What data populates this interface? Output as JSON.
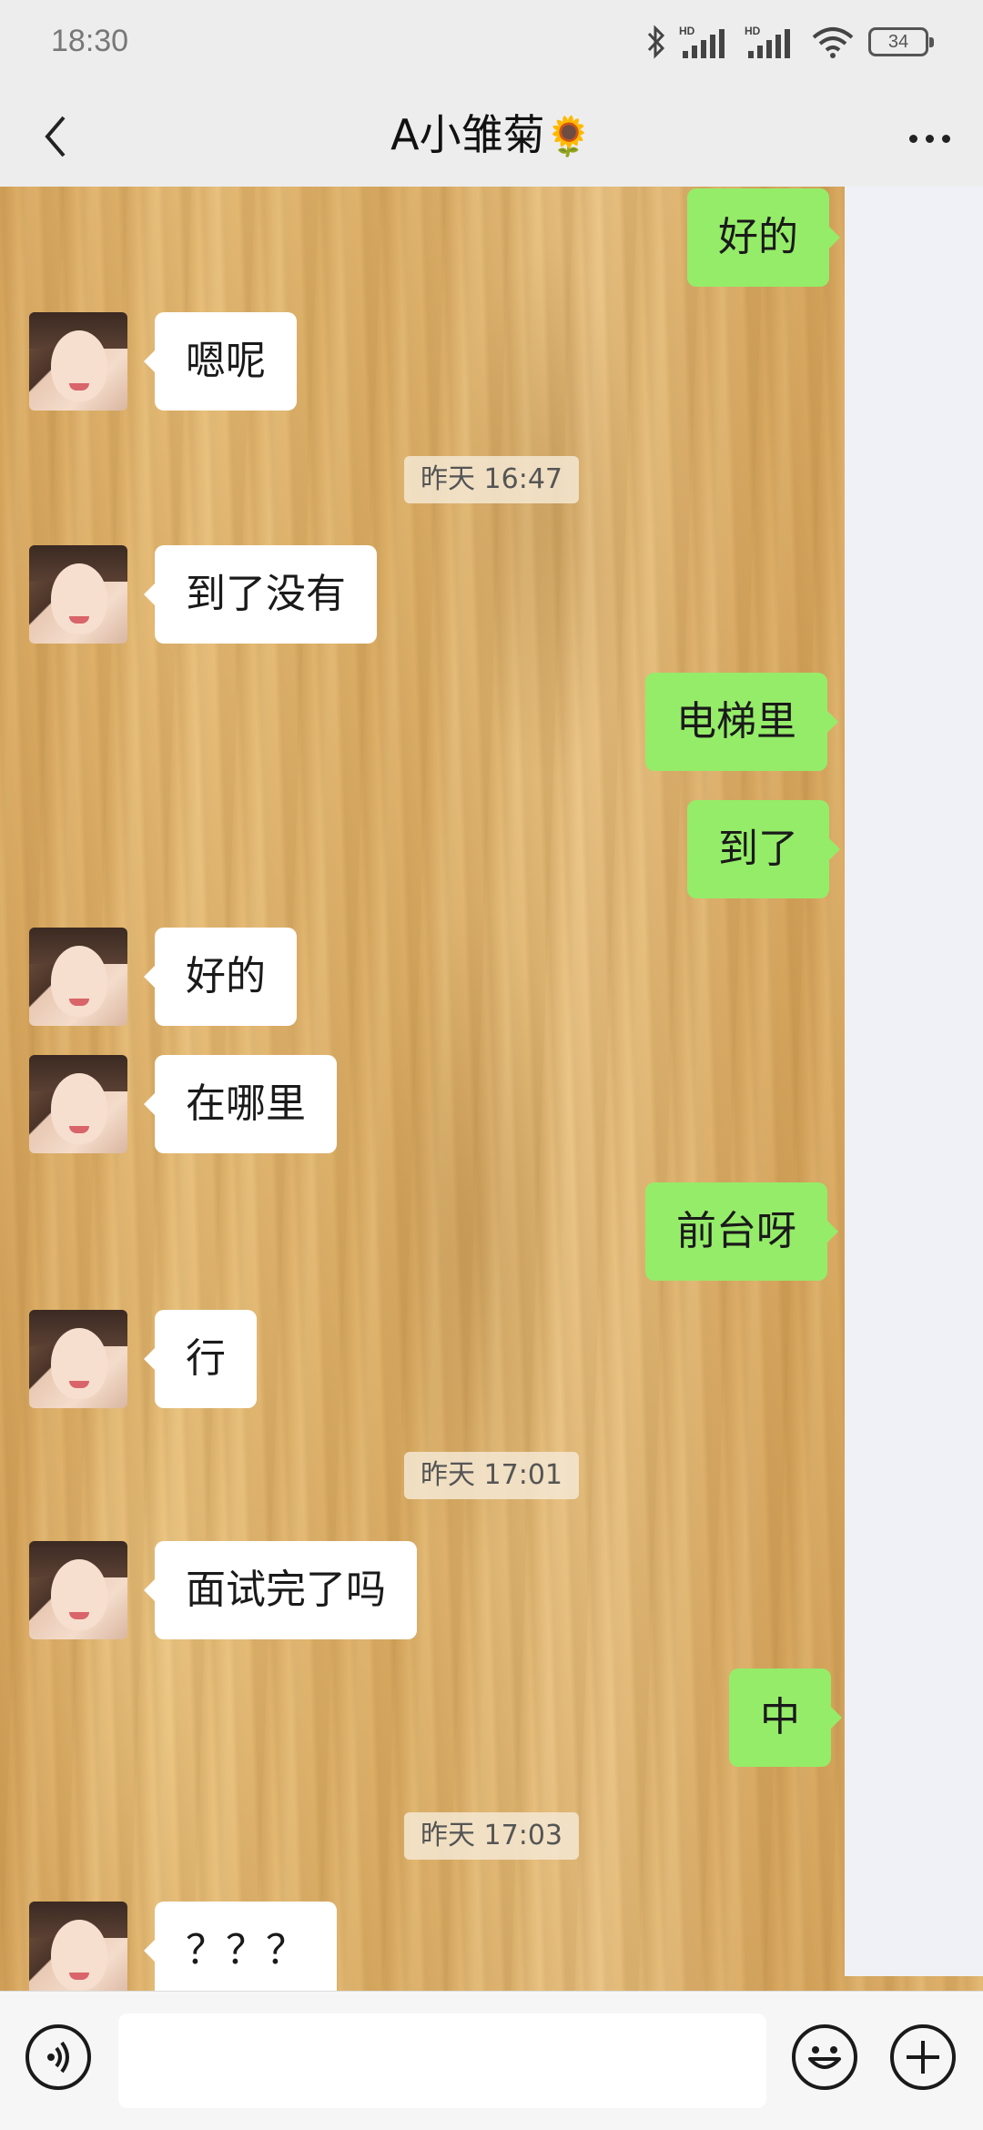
{
  "status_bar": {
    "time": "18:30",
    "battery": "34",
    "icons": [
      "bluetooth-icon",
      "hd-signal-icon",
      "hd-signal-icon",
      "wifi-icon",
      "battery-icon"
    ]
  },
  "header": {
    "title": "A小雏菊",
    "title_emoji": "🌻",
    "back_icon": "chevron-left-icon",
    "more_icon": "more-dots-icon"
  },
  "messages": [
    {
      "side": "right",
      "text": "好的"
    },
    {
      "side": "left",
      "text": "嗯呢"
    },
    {
      "type": "time",
      "text": "昨天 16:47"
    },
    {
      "side": "left",
      "text": "到了没有"
    },
    {
      "side": "right",
      "text": "电梯里"
    },
    {
      "side": "right",
      "text": "到了"
    },
    {
      "side": "left",
      "text": "好的"
    },
    {
      "side": "left",
      "text": "在哪里"
    },
    {
      "side": "right",
      "text": "前台呀"
    },
    {
      "side": "left",
      "text": "行"
    },
    {
      "type": "time",
      "text": "昨天 17:01"
    },
    {
      "side": "left",
      "text": "面试完了吗"
    },
    {
      "side": "right",
      "text": "中"
    },
    {
      "type": "time",
      "text": "昨天 17:03"
    },
    {
      "side": "left",
      "text": "？？？"
    }
  ],
  "input_bar": {
    "voice_icon": "voice-icon",
    "emoji_icon": "smiley-icon",
    "plus_icon": "plus-icon",
    "text_value": ""
  },
  "colors": {
    "accent_bubble": "#95ec69",
    "incoming_bubble": "#ffffff",
    "header_bg": "#ededed"
  }
}
